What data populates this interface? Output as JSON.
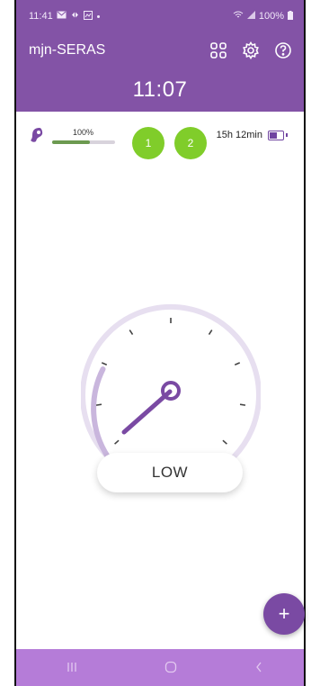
{
  "status_bar": {
    "time": "11:41",
    "left_icons": [
      "mail-icon",
      "link-icon",
      "gallery-icon",
      "dot-icon"
    ],
    "battery_text": "100%"
  },
  "app": {
    "title": "mjn-SERAS",
    "clock": "11:07",
    "accent_color": "#8353a6"
  },
  "device": {
    "volume_percent_label": "100%",
    "volume_level": 1.0,
    "programs": [
      "1",
      "2"
    ],
    "battery_time": "15h 12min"
  },
  "control": {
    "mode_label": "LOW",
    "dial_ticks": 9
  },
  "fab": {
    "label": "+"
  },
  "nav": {
    "recents": "recents-icon",
    "home": "home-icon",
    "back": "back-icon"
  }
}
